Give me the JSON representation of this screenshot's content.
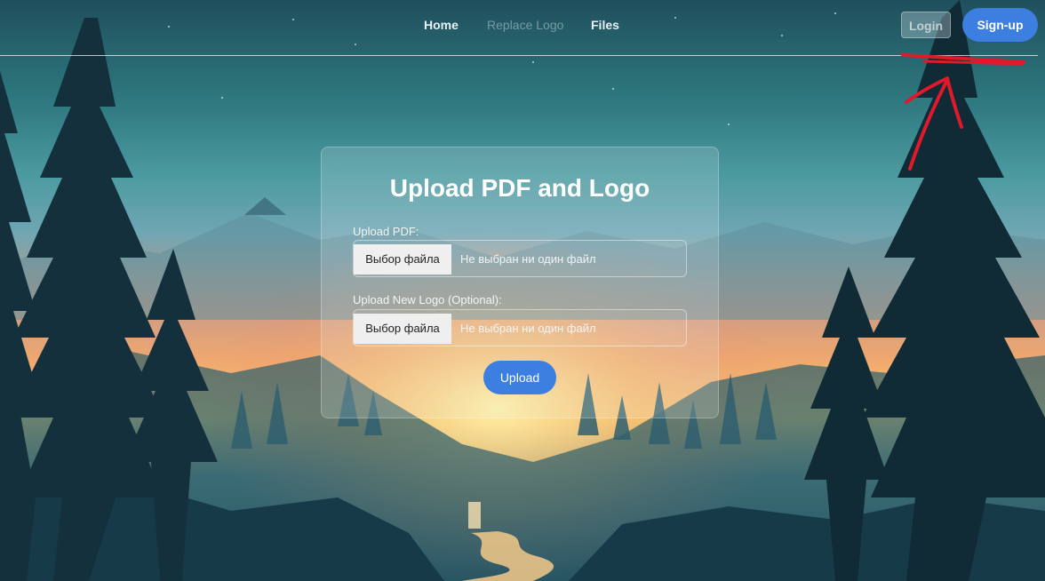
{
  "nav": {
    "links": [
      {
        "label": "Home"
      },
      {
        "label": "Replace Logo"
      },
      {
        "label": "Files"
      }
    ],
    "login_label": "Login",
    "signup_label": "Sign-up"
  },
  "card": {
    "title": "Upload PDF and Logo",
    "pdf_label": "Upload PDF:",
    "logo_label": "Upload New Logo (Optional):",
    "choose_file_label": "Выбор файла",
    "no_file_text": "Не выбран ни один файл",
    "upload_label": "Upload"
  },
  "colors": {
    "accent": "#3d7fe0",
    "annotation": "#e0192b"
  }
}
